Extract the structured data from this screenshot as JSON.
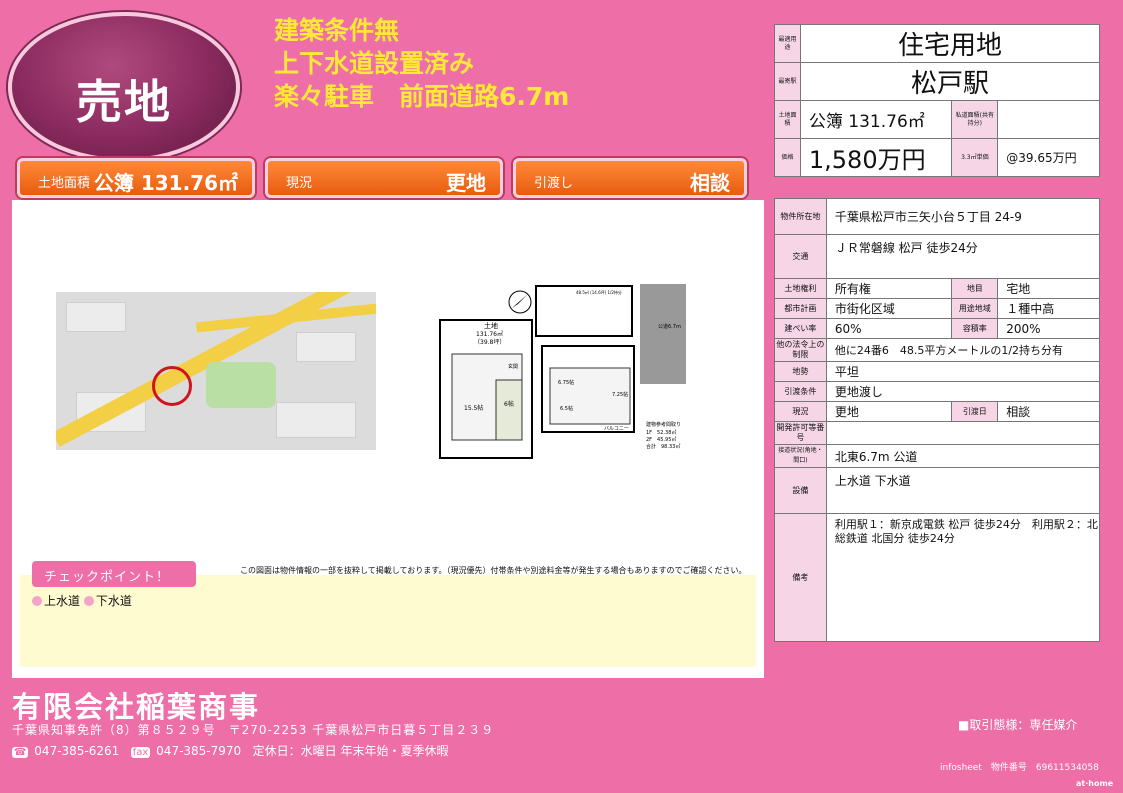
{
  "badge": "売地",
  "headlines": [
    "建築条件無",
    "上下水道設置済み",
    "楽々駐車　前面道路6.7m"
  ],
  "bars": [
    {
      "key": "土地面積",
      "value": "公簿 131.76㎡"
    },
    {
      "key": "現況",
      "value": "更地"
    },
    {
      "key": "引渡し",
      "value": "相談"
    }
  ],
  "summary": {
    "use_label": "最適用途",
    "use": "住宅用地",
    "station_label": "最寄駅",
    "station": "松戸駅",
    "area_label": "土地面積",
    "area": "公簿 131.76㎡",
    "private_road_label": "私道面積(共有持分)",
    "private_road": "",
    "price_label": "価格",
    "price": "1,580万円",
    "unit_label": "3.3㎡単価",
    "unit": "@39.65万円"
  },
  "details": {
    "address_label": "物件所在地",
    "address": "千葉県松戸市三矢小台５丁目 24-9",
    "traffic_label": "交通",
    "traffic": "ＪＲ常磐線 松戸 徒歩24分",
    "rights_label": "土地権利",
    "rights": "所有権",
    "chimoku_label": "地目",
    "chimoku": "宅地",
    "city_plan_label": "都市計画",
    "city_plan": "市街化区域",
    "zoning_label": "用途地域",
    "zoning": "１種中高",
    "bcr_label": "建ぺい率",
    "bcr": "60%",
    "far_label": "容積率",
    "far": "200%",
    "legal_label": "他の法令上の制限",
    "legal": "他に24番6　48.5平方メートルの1/2持ち分有",
    "terrain_label": "地勢",
    "terrain": "平坦",
    "handover_cond_label": "引渡条件",
    "handover_cond": "更地渡し",
    "status_label": "現況",
    "status": "更地",
    "handover_label": "引渡日",
    "handover": "相談",
    "dev_label": "開発許可等番号",
    "dev": "",
    "road_label": "接道状況(角地・間口)",
    "road": "北東6.7m 公道",
    "facilities_label": "設備",
    "facilities": "上水道 下水道",
    "remarks_label": "備考",
    "remarks": "利用駅１：新京成電鉄 松戸 徒歩24分　利用駅２：北総鉄道 北国分 徒歩24分"
  },
  "notice": "この図面は物件情報の一部を抜粋して掲載しております。（現況優先）付帯条件や別途料金等が発生する場合もありますのでご確認ください。",
  "checkpoint": {
    "title": "チェックポイント！",
    "items": [
      "上水道",
      "下水道"
    ]
  },
  "plan": {
    "land": "土地",
    "land_area": "131.76㎡",
    "land_tsubo": "（39.8坪）",
    "road": "公道6.7m",
    "r1": "15.5帖",
    "r2": "6帖",
    "r3": "6.75帖",
    "r4": "6.5帖",
    "r5": "7.25帖",
    "balcony": "バルコニー",
    "entry": "玄関",
    "bldg_title": "建物参考間取り",
    "f1": "1F　52.38㎡",
    "f2": "2F　45.95㎡",
    "total": "合計　98.33㎡",
    "top_note": "48.5㎡ (14.6坪) 1/2持分"
  },
  "footer": {
    "company": "有限会社稲葉商事",
    "license": "千葉県知事免許（8）第８５２９号　〒270-2253 千葉県松戸市日暮５丁目２３９",
    "tel_icon": "☎",
    "tel": "047-385-6261",
    "fax_icon": "fax",
    "fax": "047-385-7970",
    "holiday": "定休日：水曜日 年末年始・夏季休暇",
    "transaction": "■取引態様：専任媒介",
    "infosheet": "infosheet　物件番号　69611534058",
    "brand": "at·home"
  },
  "colors": {
    "background": "#ee6ea8",
    "accent_orange": "#e85c0e",
    "headline_yellow": "#ffe838",
    "label_pink": "#f6d6e6"
  }
}
